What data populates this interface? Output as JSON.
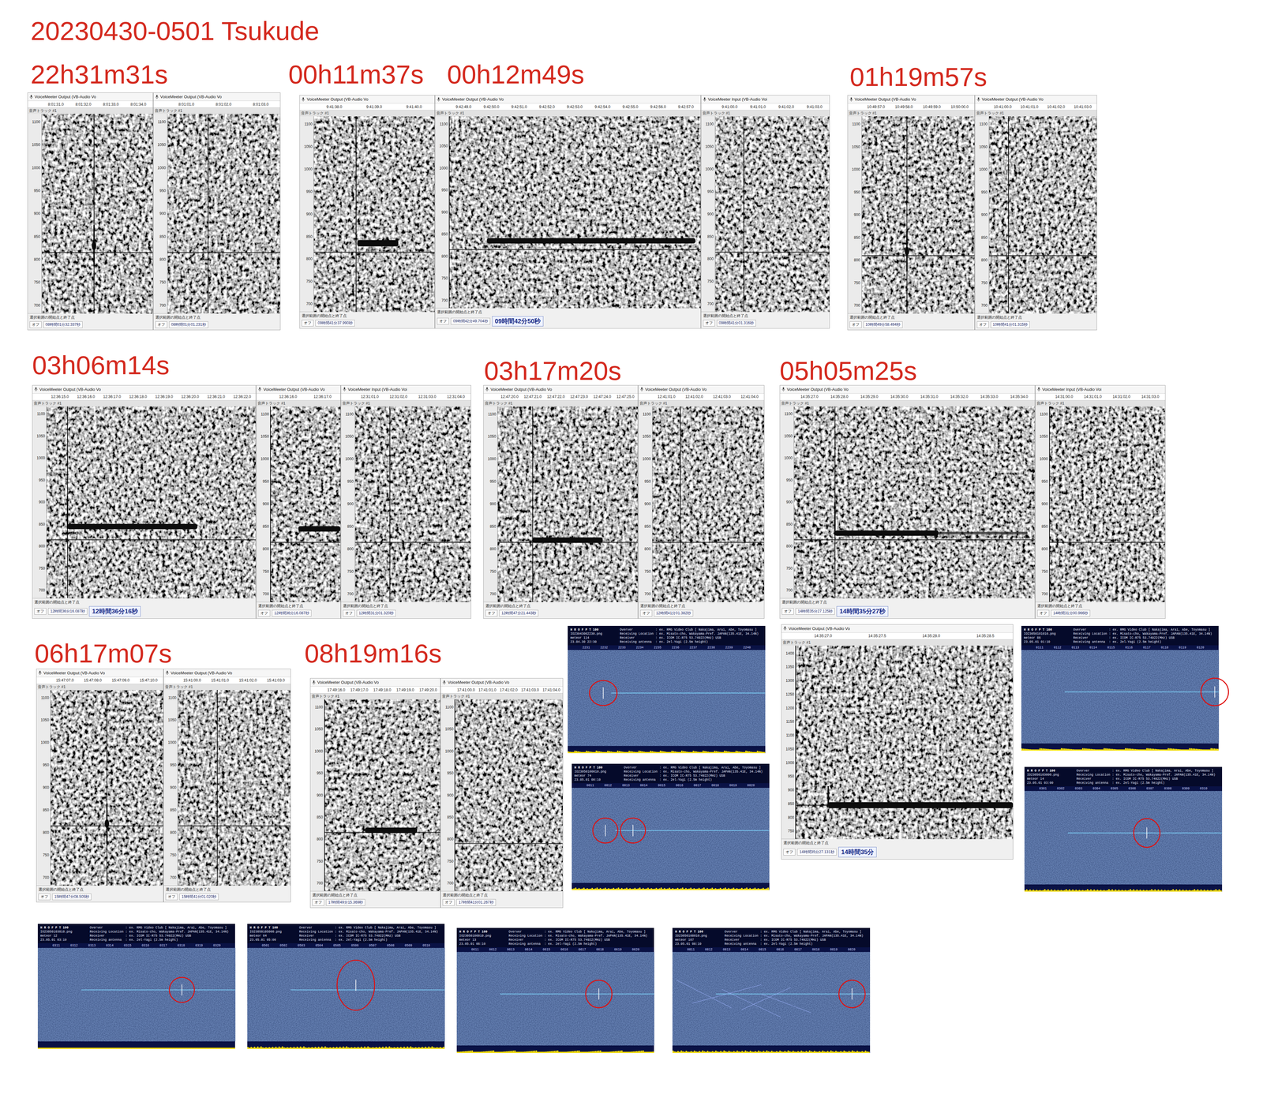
{
  "title": "20230430-0501  Tsukude",
  "headings": [
    "22h31m31s",
    "00h11m37s",
    "00h12m49s",
    "01h19m57s",
    "03h06m14s",
    "03h17m20s",
    "05h05m25s",
    "06h17m07s",
    "08h19m16s"
  ],
  "audacity": {
    "track_label": "音声トラック #1",
    "snap": "オフ",
    "range_label": "選択範囲の開始点と終了点"
  },
  "axes": {
    "narrow": [
      "1100",
      "1050",
      "1000",
      "950",
      "900",
      "850",
      "800",
      "750",
      "700"
    ],
    "wide": [
      "1400",
      "1350",
      "1300",
      "1250",
      "1200",
      "1150",
      "1100",
      "1050",
      "1000",
      "950",
      "900",
      "850",
      "800",
      "750"
    ]
  },
  "panels": [
    {
      "device": "VoiceMeeter Output (VB-Audio Vo",
      "ticks": [
        "8:01:31.0",
        "8:01:32.0",
        "8:01:33.0",
        "8:01:34.0"
      ],
      "axis": "narrow",
      "carrier": 815,
      "cursor": 0.47,
      "echo": {
        "kind": "blip",
        "at": 0.47,
        "freq": 830
      },
      "field": "08時間01分32.337秒",
      "readout": ""
    },
    {
      "device": "VoiceMeeter Output (VB-Audio Vo",
      "ticks": [
        "8:01:01.0",
        "8:01:02.0",
        "8:01:03.0"
      ],
      "axis": "narrow",
      "carrier": 815,
      "cursor": 0.36,
      "echo": {
        "kind": "none"
      },
      "field": "08時間01分01.231秒",
      "readout": ""
    },
    {
      "device": "VoiceMeeter Output (VB-Audio Vo",
      "ticks": [
        "9:41:38.0",
        "9:41:39.0",
        "9:41:40.0"
      ],
      "axis": "narrow",
      "carrier": 815,
      "cursor": 0.35,
      "echo": {
        "kind": "band",
        "start": 0.36,
        "end": 0.7,
        "freq": 835,
        "width": 14,
        "spike": false,
        "tail": 0
      },
      "field": "09時間41分37.990秒",
      "readout": ""
    },
    {
      "device": "VoiceMeeter Output (VB-Audio Vo",
      "ticks": [
        "9:42:49.0",
        "9:42:50.0",
        "9:42:51.0",
        "9:42:52.0",
        "9:42:53.0",
        "9:42:54.0",
        "9:42:55.0",
        "9:42:56.0",
        "9:42:57.0"
      ],
      "axis": "narrow",
      "carrier": 815,
      "cursor": 0,
      "echo": {
        "kind": "band",
        "start": 0.15,
        "end": 0.98,
        "freq": 835,
        "width": 12,
        "spike": false,
        "tail": 0
      },
      "field": "09時間42分49.704秒",
      "readout": "09時間42分50秒"
    },
    {
      "device": "VoiceMeeter Input (VB-Audio Voi",
      "ticks": [
        "9:41:00.0",
        "9:41:01.0",
        "9:41:02.0",
        "9:41:03.0"
      ],
      "axis": "narrow",
      "carrier": 815,
      "cursor": 0.25,
      "echo": {
        "kind": "none"
      },
      "field": "09時間41分01.316秒",
      "readout": ""
    },
    {
      "device": "VoiceMeeter Output (VB-Audio Vo",
      "ticks": [
        "10:49:57.0",
        "10:49:58.0",
        "10:49:59.0",
        "10:50:00.0"
      ],
      "axis": "narrow",
      "carrier": 810,
      "cursor": 0.4,
      "echo": {
        "kind": "blip",
        "at": 0.4,
        "freq": 820
      },
      "field": "10時間49分58.494秒",
      "readout": ""
    },
    {
      "device": "VoiceMeeter Output (VB-Audio Vo",
      "ticks": [
        "10:41:00.0",
        "10:41:01.0",
        "10:41:02.0",
        "10:41:03.0"
      ],
      "axis": "narrow",
      "carrier": 810,
      "cursor": 0.18,
      "echo": {
        "kind": "none"
      },
      "field": "10時間41分01.315秒",
      "readout": ""
    },
    {
      "device": "VoiceMeeter Output (VB-Audio Vo",
      "ticks": [
        "12:36:15.0",
        "12:36:16.0",
        "12:36:17.0",
        "12:36:18.0",
        "12:36:19.0",
        "12:36:20.0",
        "12:36:21.0",
        "12:36:22.0"
      ],
      "axis": "narrow",
      "carrier": 815,
      "cursor": 0.1,
      "echo": {
        "kind": "band",
        "start": 0.1,
        "end": 0.72,
        "freq": 845,
        "width": 12,
        "spike": true,
        "tail": 0
      },
      "field": "12時間36分16.087秒",
      "readout": "12時間36分16秒"
    },
    {
      "device": "VoiceMeeter Output (VB-Audio Vo",
      "ticks": [
        "12:36:16.0",
        "12:36:17.0"
      ],
      "axis": "narrow",
      "carrier": 815,
      "cursor": 0,
      "echo": {
        "kind": "band",
        "start": 0.4,
        "end": 1,
        "freq": 845,
        "width": 12,
        "spike": false,
        "tail": 0
      },
      "field": "12時間36分16.087秒",
      "readout": ""
    },
    {
      "device": "VoiceMeeter Input (VB-Audio Voi",
      "ticks": [
        "12:31:01.0",
        "12:31:02.0",
        "12:31:03.0",
        "12:31:04.0"
      ],
      "axis": "narrow",
      "carrier": 815,
      "cursor": 0.3,
      "echo": {
        "kind": "none"
      },
      "field": "12時間31分01.320秒",
      "readout": ""
    },
    {
      "device": "VoiceMeeter Output (VB-Audio Vo",
      "ticks": [
        "12:47:20.0",
        "12:47:21.0",
        "12:47:22.0",
        "12:47:23.0",
        "12:47:24.0",
        "12:47:25.0"
      ],
      "axis": "narrow",
      "carrier": 815,
      "cursor": 0.25,
      "echo": {
        "kind": "band",
        "start": 0.25,
        "end": 0.75,
        "freq": 820,
        "width": 12,
        "spike": false,
        "tail": 0
      },
      "field": "12時間47分21.443秒",
      "readout": ""
    },
    {
      "device": "VoiceMeeter Output (VB-Audio Vo",
      "ticks": [
        "12:41:01.0",
        "12:41:02.0",
        "12:41:03.0",
        "12:41:04.0"
      ],
      "axis": "narrow",
      "carrier": 815,
      "cursor": 0.25,
      "echo": {
        "kind": "none"
      },
      "field": "12時間41分01.382秒",
      "readout": ""
    },
    {
      "device": "VoiceMeeter Output (VB-Audio Vo",
      "ticks": [
        "14:35:27.0",
        "14:35:28.0",
        "14:35:29.0",
        "14:35:30.0",
        "14:35:31.0",
        "14:35:32.0",
        "14:35:33.0",
        "14:35:34.0"
      ],
      "axis": "narrow",
      "carrier": 815,
      "cursor": 0.17,
      "echo": {
        "kind": "band",
        "start": 0.17,
        "end": 0.6,
        "freq": 830,
        "width": 12,
        "spike": true,
        "tail": 0.97
      },
      "field": "14時間35分27.125秒",
      "readout": "14時間35分27秒"
    },
    {
      "device": "VoiceMeeter Input (VB-Audio Voi",
      "ticks": [
        "14:31:00.0",
        "14:31:01.0",
        "14:31:02.0",
        "14:31:03.0"
      ],
      "axis": "narrow",
      "carrier": 815,
      "cursor": 0,
      "echo": {
        "kind": "none"
      },
      "field": "14時間31分00.966秒",
      "readout": ""
    },
    {
      "device": "VoiceMeeter Output (VB-Audio Vo",
      "ticks": [
        "14:35:27.0",
        "14:35:27.5",
        "14:35:28.0",
        "14:35:28.5"
      ],
      "axis": "wide",
      "carrier": 845,
      "cursor": 0,
      "echo": {
        "kind": "band",
        "start": 0.15,
        "end": 1,
        "freq": 845,
        "width": 22,
        "spike": true,
        "tail": 0
      },
      "field": "14時間35分27.131秒",
      "readout": "14時間35分"
    },
    {
      "device": "VoiceMeeter Output (VB-Audio Vo",
      "ticks": [
        "15:47:07.0",
        "15:47:08.0",
        "15:47:09.0",
        "15:47:10.0"
      ],
      "axis": "narrow",
      "carrier": 815,
      "cursor": 0.5,
      "echo": {
        "kind": "blip",
        "at": 0.5,
        "freq": 820
      },
      "field": "15時間47分08.505秒",
      "readout": ""
    },
    {
      "device": "VoiceMeeter Output (VB-Audio Vo",
      "ticks": [
        "15:41:00.0",
        "15:41:01.0",
        "15:41:02.0",
        "15:41:03.0"
      ],
      "axis": "narrow",
      "carrier": 815,
      "cursor": 0.35,
      "echo": {
        "kind": "none"
      },
      "field": "15時間41分01.020秒",
      "readout": ""
    },
    {
      "device": "VoiceMeeter Output (VB-Audio Vo",
      "ticks": [
        "17:49:16.0",
        "17:49:17.0",
        "17:49:18.0",
        "17:49:19.0",
        "17:49:20.0"
      ],
      "axis": "narrow",
      "carrier": 815,
      "cursor": 0,
      "echo": {
        "kind": "band",
        "start": 0.35,
        "end": 0.8,
        "freq": 820,
        "width": 12,
        "spike": false,
        "tail": 0
      },
      "field": "17時間49分15.369秒",
      "readout": ""
    },
    {
      "device": "VoiceMeeter Output (VB-Audio Vo",
      "ticks": [
        "17:41:00.0",
        "17:41:01.0",
        "17:41:02.0",
        "17:41:03.0",
        "17:41:04.0"
      ],
      "axis": "narrow",
      "carrier": 790,
      "cursor": 0,
      "echo": {
        "kind": "none"
      },
      "field": "17時間41分01.267秒",
      "readout": ""
    }
  ],
  "hrofft_info": [
    "Overver            : ex. RMG Video Club [ Nakajima, Arai, Abe, Toyomasu ]",
    "Receiving Location : ex. Misato-cho, Wakayama-Pref. JAPAN(135.41E, 34.14N)",
    "Receiver           : ex. ICOM IC-R75 53.74922(MHz) USB",
    "Receiving antenna  : ex. 2el-Yagi (2.5m height)"
  ],
  "hrofft": [
    {
      "logo": "H R O F P T 100",
      "file": "IO23043002230.png",
      "label": "meteor",
      "count": "114",
      "date": "23.04.30 22:30",
      "ticks": [
        "2231",
        "2232",
        "2233",
        "2234",
        "2235",
        "2236",
        "2237",
        "2238",
        "2239",
        "2240"
      ],
      "aircraft": false
    },
    {
      "logo": "H R O F P T 100",
      "file": "IO23050100010.png",
      "label": "meteor",
      "count": "74",
      "date": "23.05.01 00:10",
      "ticks": [
        "0011",
        "0012",
        "0013",
        "0014",
        "0015",
        "0016",
        "0017",
        "0018",
        "0019",
        "0020"
      ],
      "aircraft": false
    },
    {
      "logo": "H R O F P T 100",
      "file": "IO23050101010.png",
      "label": "meteor",
      "count": "86",
      "date": "23.05.01 01:10",
      "ticks": [
        "0111",
        "0112",
        "0113",
        "0114",
        "0115",
        "0116",
        "0117",
        "0118",
        "0119",
        "0120"
      ],
      "aircraft": false
    },
    {
      "logo": "H R O F P T 100",
      "file": "IO23050103000.png",
      "label": "meteor",
      "count": "14",
      "date": "23.05.01 03:00",
      "ticks": [
        "0301",
        "0302",
        "0303",
        "0304",
        "0305",
        "0306",
        "0307",
        "0308",
        "0309",
        "0310"
      ],
      "aircraft": false
    },
    {
      "logo": "H R O F P T 100",
      "file": "IO23050103010.png",
      "label": "meteor",
      "count": "12",
      "date": "23.05.01 03:10",
      "ticks": [
        "0311",
        "0312",
        "0313",
        "0314",
        "0315",
        "0316",
        "0317",
        "0318",
        "0319",
        "0320"
      ],
      "aircraft": false
    },
    {
      "logo": "H R O F P T 100",
      "file": "IO23050105000.png",
      "label": "meteor",
      "count": "64",
      "date": "23.05.01 05:00",
      "ticks": [
        "0501",
        "0502",
        "0503",
        "0504",
        "0505",
        "0506",
        "0507",
        "0508",
        "0509",
        "0510"
      ],
      "aircraft": false
    },
    {
      "logo": "H R O F P T 100",
      "file": "IO23050106010.png",
      "label": "meteor",
      "count": "13",
      "date": "23.05.01 06:10",
      "ticks": [
        "0611",
        "0612",
        "0613",
        "0614",
        "0615",
        "0616",
        "0617",
        "0618",
        "0619",
        "0620"
      ],
      "aircraft": false
    },
    {
      "logo": "H R O F P T 100",
      "file": "IO23050108010.png",
      "label": "meteor",
      "count": "107",
      "date": "23.05.01 08:10",
      "ticks": [
        "0811",
        "0812",
        "0813",
        "0814",
        "0815",
        "0816",
        "0817",
        "0818",
        "0819",
        "0820"
      ],
      "aircraft": true
    }
  ]
}
